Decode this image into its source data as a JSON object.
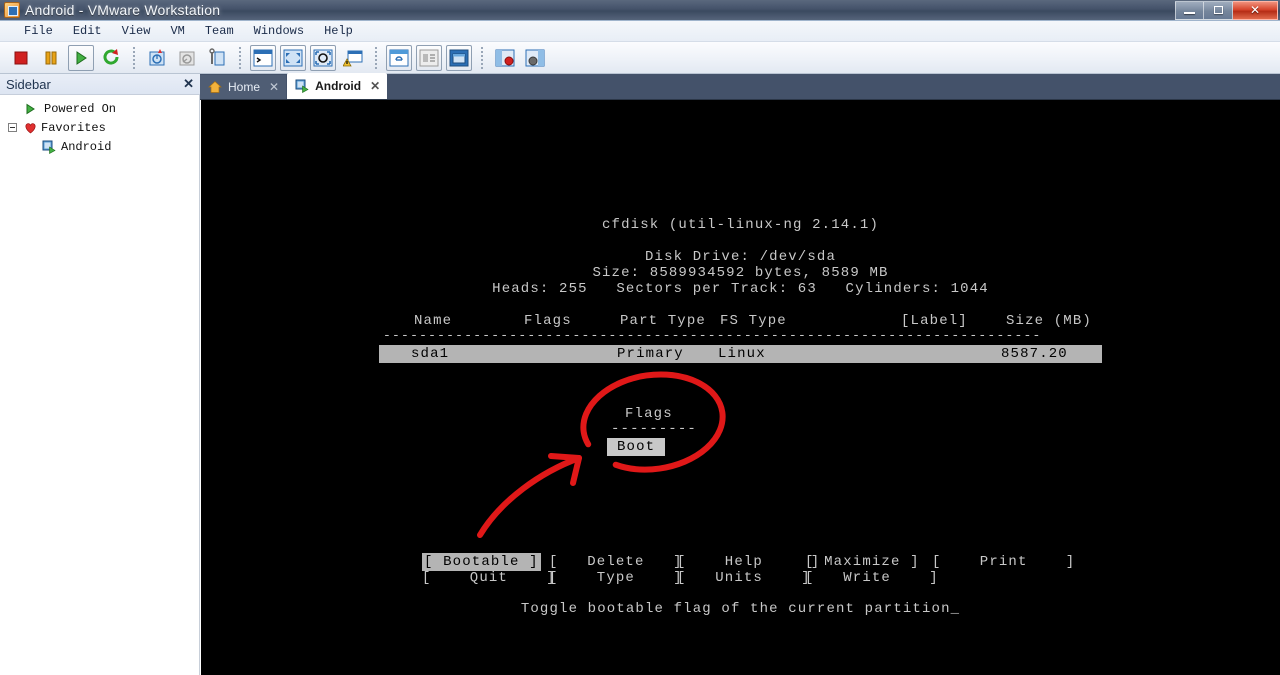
{
  "window": {
    "title": "Android - VMware Workstation",
    "icon": "vmware-app-icon",
    "controls": {
      "minimize": "minimize-button",
      "maximize": "maximize-button",
      "close": "close-button"
    }
  },
  "menubar": {
    "items": [
      "File",
      "Edit",
      "View",
      "VM",
      "Team",
      "Windows",
      "Help"
    ]
  },
  "toolbar": {
    "groups": [
      [
        {
          "name": "power-off-icon",
          "glyph": "stop"
        },
        {
          "name": "suspend-icon",
          "glyph": "pause"
        },
        {
          "name": "power-on-icon",
          "glyph": "play",
          "framed": true
        },
        {
          "name": "reset-icon",
          "glyph": "reset"
        }
      ],
      [
        {
          "name": "snapshot-take-icon",
          "glyph": "snap-take"
        },
        {
          "name": "snapshot-revert-icon",
          "glyph": "snap-revert"
        },
        {
          "name": "snapshot-manager-icon",
          "glyph": "snap-manage"
        }
      ],
      [
        {
          "name": "console-view-icon",
          "glyph": "console"
        },
        {
          "name": "fit-guest-icon",
          "glyph": "fit"
        },
        {
          "name": "fullscreen-icon",
          "glyph": "fullscreen"
        },
        {
          "name": "quick-switch-icon",
          "glyph": "quickswitch"
        }
      ],
      [
        {
          "name": "summary-view-icon",
          "glyph": "summary"
        },
        {
          "name": "thumbnail-view-icon",
          "glyph": "thumbs"
        },
        {
          "name": "multiple-windows-icon",
          "glyph": "multiwin",
          "framed": true
        }
      ],
      [
        {
          "name": "show-sidebar-icon",
          "glyph": "sidebar-left"
        },
        {
          "name": "show-thumbnail-bar-icon",
          "glyph": "sidebar-right"
        }
      ]
    ]
  },
  "tabs": [
    {
      "label": "Home",
      "icon": "home-icon",
      "active": false,
      "closable": true
    },
    {
      "label": "Android",
      "icon": "vm-icon",
      "active": true,
      "closable": true
    }
  ],
  "sidebar": {
    "title": "Sidebar",
    "close_label": "✕",
    "items": [
      {
        "label": "Powered On",
        "icon": "powered-on-icon",
        "indent": 26,
        "expander": false
      },
      {
        "label": "Favorites",
        "icon": "favorites-heart-icon",
        "indent": 26,
        "expander": true
      },
      {
        "label": "Android",
        "icon": "vm-icon",
        "indent": 44,
        "expander": false
      }
    ]
  },
  "terminal": {
    "title": "cfdisk (util-linux-ng 2.14.1)",
    "disk_drive": "Disk Drive: /dev/sda",
    "size": "Size: 8589934592 bytes, 8589 MB",
    "geometry": "Heads: 255   Sectors per Track: 63   Cylinders: 1044",
    "table": {
      "headers": [
        "Name",
        "Flags",
        "Part Type",
        "FS Type",
        "[Label]",
        "Size (MB)"
      ],
      "separator": "-------------------------------------------------------------------------",
      "rows": [
        {
          "name": "sda1",
          "flags": "",
          "part_type": "Primary",
          "fs_type": "Linux",
          "label": "",
          "size": "8587.20",
          "selected": true
        }
      ]
    },
    "flags_dialog": {
      "title": "Flags",
      "rule": "---------",
      "options": [
        {
          "label": "Boot",
          "selected": true
        }
      ]
    },
    "menu_rows": [
      [
        {
          "label": "Bootable",
          "selected": true
        },
        {
          "label": "Delete",
          "selected": false
        },
        {
          "label": "Help",
          "selected": false
        },
        {
          "label": "Maximize",
          "selected": false
        },
        {
          "label": "Print",
          "selected": false
        }
      ],
      [
        {
          "label": "Quit",
          "selected": false
        },
        {
          "label": "Type",
          "selected": false
        },
        {
          "label": "Units",
          "selected": false
        },
        {
          "label": "Write",
          "selected": false
        }
      ]
    ],
    "status": "Toggle bootable flag of the current partition_"
  },
  "annotations": {
    "color": "#e01818",
    "shapes": [
      {
        "name": "red-circle-around-flags-dialog"
      },
      {
        "name": "red-arrow-pointing-to-flags-dialog"
      }
    ]
  }
}
